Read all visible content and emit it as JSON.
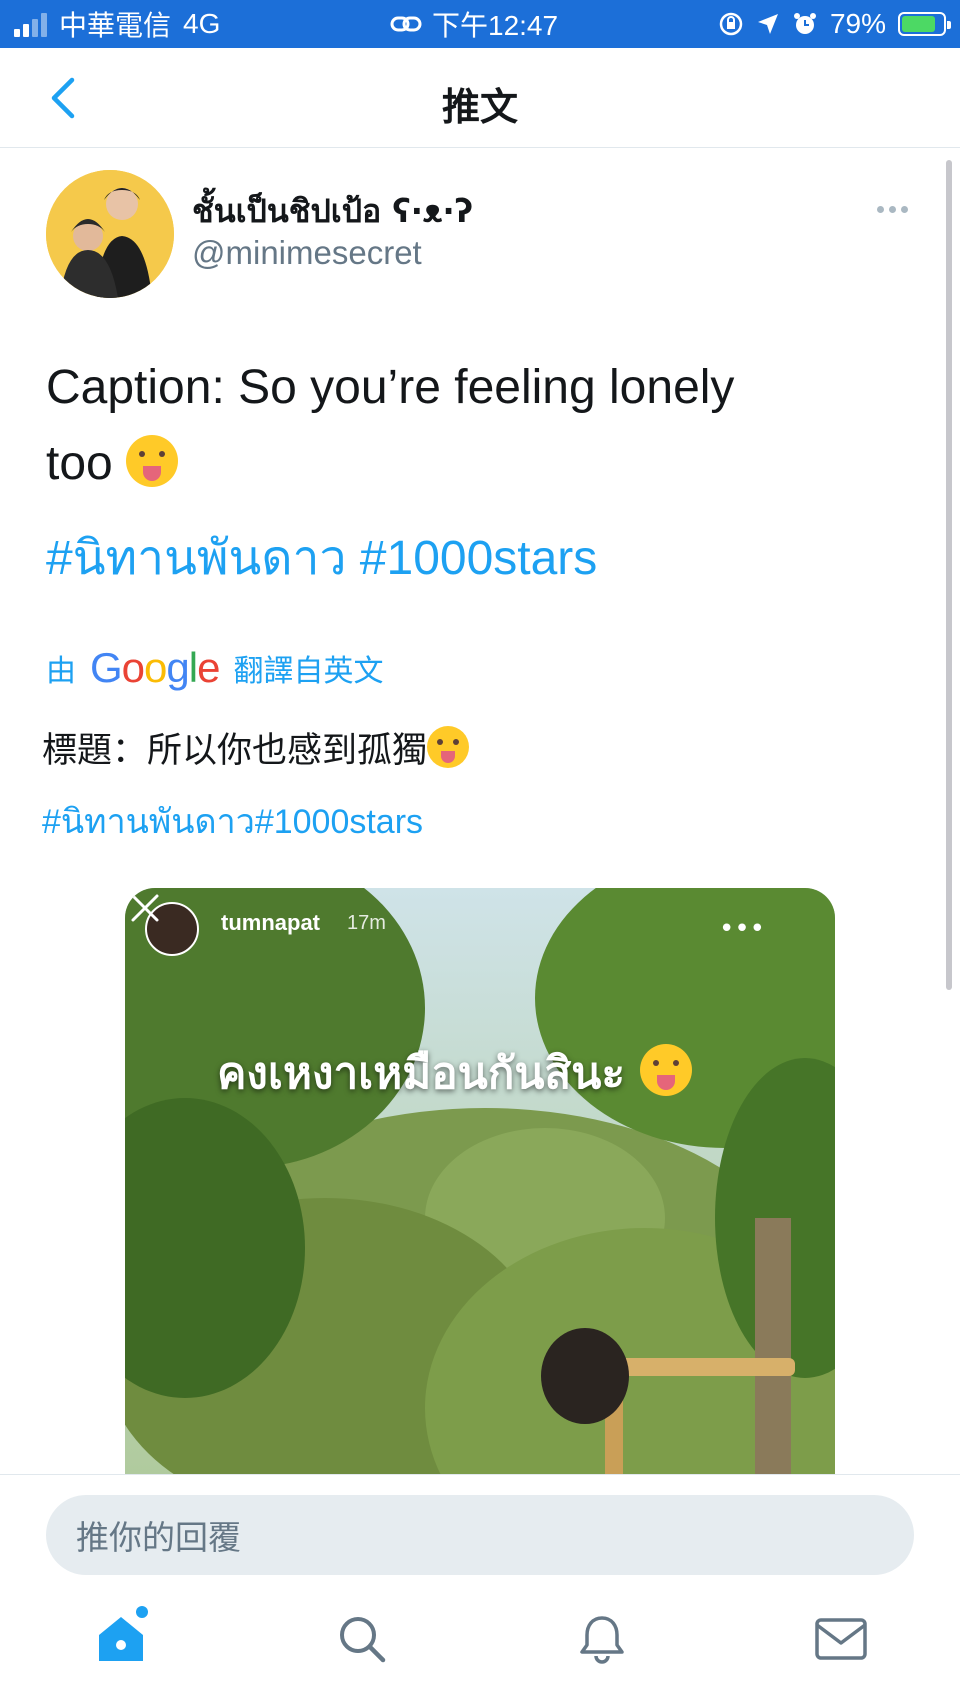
{
  "status_bar": {
    "carrier": "中華電信",
    "network": "4G",
    "time": "下午12:47",
    "battery_percent": "79%"
  },
  "header": {
    "title": "推文"
  },
  "tweet": {
    "display_name": "ชั้นเป็นชิปเป้อ ʕ·ᴥ·ʔ",
    "handle": "@minimesecret",
    "text_line1": "Caption: So you’re feeling lonely",
    "text_line2": "too",
    "hashtags": [
      "#นิทานพันดาว",
      "#1000stars"
    ],
    "translation": {
      "prefix": "由",
      "provider": "Google",
      "suffix": "翻譯自英文",
      "text": "標題：所以你也感到孤獨",
      "hashtags": "#นิทานพันดาว#1000stars"
    },
    "media": {
      "story_user": "tumnapat",
      "story_time": "17m",
      "story_caption": "คงเหงาเหมือนกันสินะ"
    }
  },
  "reply": {
    "placeholder": "推你的回覆"
  },
  "colors": {
    "accent": "#1da1f2",
    "status_bar": "#1c6fd8",
    "text_secondary": "#657786"
  },
  "tabs": [
    {
      "name": "home",
      "icon": "home-icon",
      "active": true
    },
    {
      "name": "search",
      "icon": "search-icon",
      "active": false
    },
    {
      "name": "notifications",
      "icon": "bell-icon",
      "active": false
    },
    {
      "name": "messages",
      "icon": "mail-icon",
      "active": false
    }
  ]
}
